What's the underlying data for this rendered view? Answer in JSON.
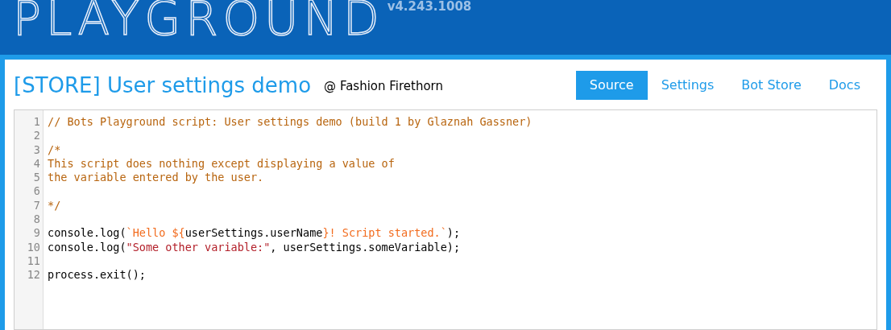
{
  "header": {
    "logo": "PLAYGROUND",
    "version": "v4.243.1008"
  },
  "title": "[STORE] User settings demo",
  "author": "@ Fashion Firethorn",
  "tabs": [
    {
      "label": "Source",
      "selected": true
    },
    {
      "label": "Settings",
      "selected": false
    },
    {
      "label": "Bot Store",
      "selected": false
    },
    {
      "label": "Docs",
      "selected": false
    }
  ],
  "editor": {
    "lines": [
      {
        "number": "1",
        "tokens": [
          {
            "kind": "comment",
            "text": "// Bots Playground script: User settings demo (build 1 by Glaznah Gassner)"
          }
        ]
      },
      {
        "number": "2"
      },
      {
        "number": "3",
        "tokens": [
          {
            "kind": "comment",
            "text": "/*"
          }
        ]
      },
      {
        "number": "4",
        "tokens": [
          {
            "kind": "comment",
            "text": "This script does nothing except displaying a value of"
          }
        ]
      },
      {
        "number": "5",
        "tokens": [
          {
            "kind": "comment",
            "text": "the variable entered by the user."
          }
        ]
      },
      {
        "number": "6"
      },
      {
        "number": "7",
        "tokens": [
          {
            "kind": "comment",
            "text": "*/"
          }
        ]
      },
      {
        "number": "8"
      },
      {
        "number": "9",
        "tokens": [
          {
            "kind": "plain",
            "text": "console.log("
          },
          {
            "kind": "template",
            "text": "`Hello ${"
          },
          {
            "kind": "plain",
            "text": "userSettings.userName"
          },
          {
            "kind": "template",
            "text": "}! Script started.`"
          },
          {
            "kind": "plain",
            "text": ");"
          }
        ]
      },
      {
        "number": "10",
        "tokens": [
          {
            "kind": "plain",
            "text": "console.log("
          },
          {
            "kind": "string",
            "text": "\"Some other variable:\""
          },
          {
            "kind": "plain",
            "text": ", userSettings.someVariable);"
          }
        ]
      },
      {
        "number": "11"
      },
      {
        "number": "12",
        "tokens": [
          {
            "kind": "plain",
            "text": "process.exit();"
          }
        ]
      }
    ]
  }
}
